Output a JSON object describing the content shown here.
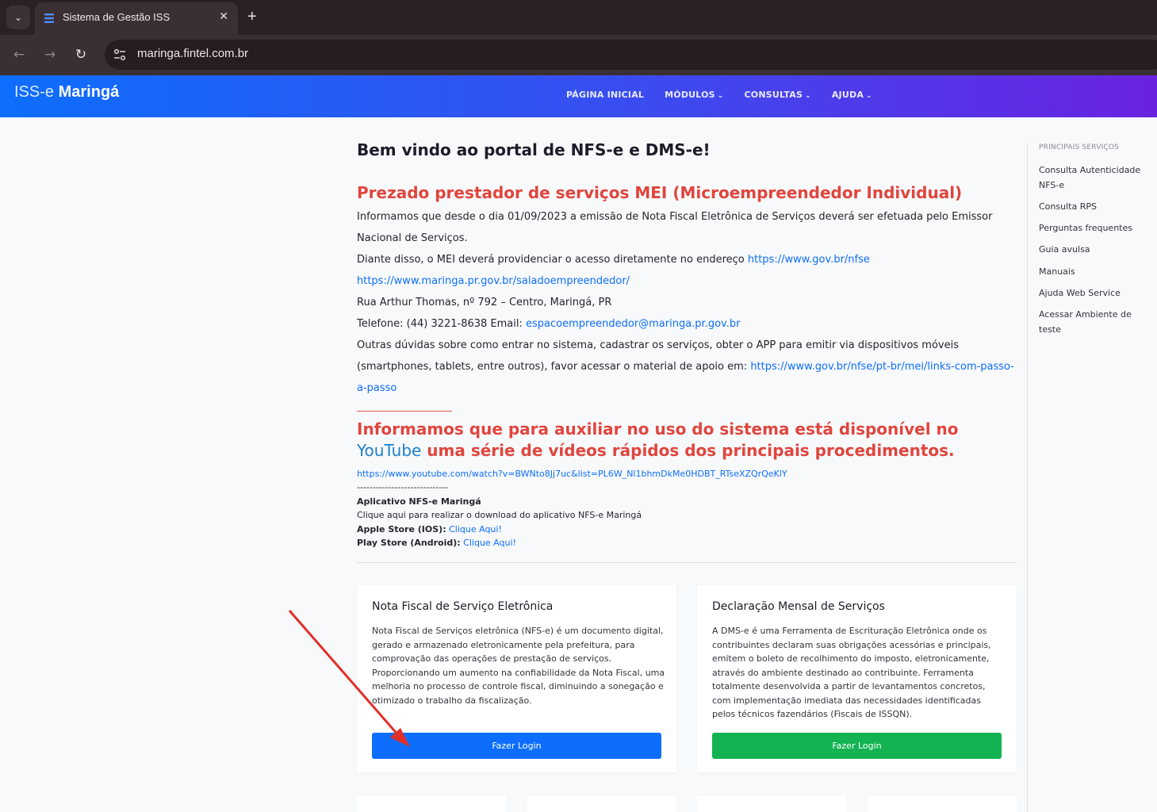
{
  "browser": {
    "tab_title": "Sistema de Gestão ISS",
    "url": "maringa.fintel.com.br",
    "new_tab_symbol": "+",
    "close_symbol": "✕"
  },
  "header": {
    "brand_light": "ISS-e",
    "brand_bold": "Maringá",
    "menu": [
      {
        "label": "PÁGINA INICIAL",
        "caret": ""
      },
      {
        "label": "MÓDULOS",
        "caret": "⌄"
      },
      {
        "label": "CONSULTAS",
        "caret": "⌄"
      },
      {
        "label": "AJUDA",
        "caret": "⌄"
      }
    ]
  },
  "content": {
    "welcome": "Bem vindo ao portal de NFS-e e DMS-e!",
    "mei_title": "Prezado prestador de serviços MEI (Microempreendedor Individual)",
    "p1": "Informamos que desde o dia 01/09/2023 a emissão de Nota Fiscal Eletrônica de Serviços deverá ser efetuada pelo Emissor Nacional de Serviços.",
    "p2_text": "Diante disso, o MEI deverá providenciar o acesso diretamente no endereço ",
    "p2_link": "https://www.gov.br/nfse",
    "link_sala": "https://www.maringa.pr.gov.br/saladoempreendedor/",
    "address": "Rua Arthur Thomas, nº 792 – Centro, Maringá, PR",
    "phone_text": "Telefone: (44) 3221-8638 Email: ",
    "email": "espacoempreendedor@maringa.pr.gov.br",
    "p3_text": "Outras dúvidas sobre como entrar no sistema, cadastrar os serviços, obter o APP para emitir via dispositivos móveis (smartphones, tablets, entre outros), favor acessar o material de apoio em: ",
    "p3_link": "https://www.gov.br/nfse/pt-br/mei/links-com-passo-a-passo",
    "separator": "____________________",
    "yt_before": "Informamos que para auxiliar no uso do sistema está disponível no ",
    "yt_word": "YouTube",
    "yt_after": " uma série de vídeos rápidos dos principais procedimentos.",
    "yt_link": "https://www.youtube.com/watch?v=BWNto8Jj7uc&list=PL6W_Nl1bhmDkMe0HDBT_RTseXZQrQeKlY",
    "dashes": "-----------------------------",
    "app_title": "Aplicativo NFS-e Maringá",
    "app_desc": "Clique aqui para realizar o download do aplicativo NFS-e Maringá",
    "apple_label": "Apple Store (IOS):",
    "apple_link": "Clique Aqui!",
    "play_label": "Play Store (Android):",
    "play_link": "Clique Aqui!"
  },
  "cards": [
    {
      "title": "Nota Fiscal de Serviço Eletrônica",
      "text": "Nota Fiscal de Serviços eletrônica (NFS-e) é um documento digital, gerado e armazenado eletronicamente pela prefeitura, para comprovação das operações de prestação de serviços. Proporcionando um aumento na confiabilidade da Nota Fiscal, uma melhoria no processo de controle fiscal, diminuindo a sonegação e otimizado o trabalho da fiscalização.",
      "button": "Fazer Login",
      "button_color": "#0d6efd"
    },
    {
      "title": "Declaração Mensal de Serviços",
      "text": "A DMS-e é uma Ferramenta de Escrituração Eletrônica onde os contribuintes declaram suas obrigações acessórias e principais, emitem o boleto de recolhimento do imposto, eletronicamente, através do ambiente destinado ao contribuinte. Ferramenta totalmente desenvolvida a partir de levantamentos concretos, com implementação imediata das necessidades identificadas pelos técnicos fazendários (Fiscais de ISSQN).",
      "button": "Fazer Login",
      "button_color": "#13b352"
    }
  ],
  "sidebar": {
    "heading": "PRINCIPAIS SERVIÇOS",
    "items": [
      "Consulta Autenticidade NFS-e",
      "Consulta RPS",
      "Perguntas frequentes",
      "Guia avulsa",
      "Manuais",
      "Ajuda Web Service",
      "Acessar Ambiente de teste"
    ]
  },
  "colors": {
    "accent_red": "#e0453d",
    "link_blue": "#0d6efd",
    "annotation_arrow": "#e0302a"
  }
}
